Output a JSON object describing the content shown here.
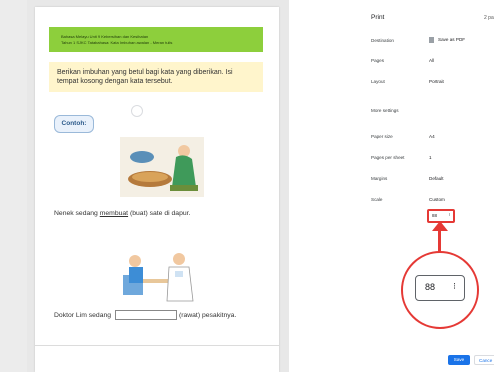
{
  "document": {
    "header_line1": "Bahasa Melayu   Unit 9 Kebersihan dan Kesihatan",
    "header_line2": "Tahun 1 SJKC     Tatabahasa: Kata Imbuhan awalan - Meran tulis",
    "instruction_line1": "Berikan imbuhan yang betul bagi kata yang diberikan. Isi",
    "instruction_line2": "tempat kosong dengan kata tersebut.",
    "example_label": "Contoh:",
    "sentence1_pre": "Nenek sedang ",
    "sentence1_answer": "membuat",
    "sentence1_post": " (buat) sate di dapur.",
    "sentence2_pre": "Doktor Lim sedang ",
    "sentence2_post": "(rawat) pesakitnya."
  },
  "print": {
    "title": "Print",
    "sheet_count": "2 pa",
    "destination_label": "Destination",
    "destination_value": "Save as PDF",
    "pages_label": "Pages",
    "pages_value": "All",
    "layout_label": "Layout",
    "layout_value": "Portrait",
    "more_settings_label": "More settings",
    "paper_size_label": "Paper size",
    "paper_size_value": "A4",
    "pages_per_sheet_label": "Pages per sheet",
    "pages_per_sheet_value": "1",
    "margins_label": "Margins",
    "margins_value": "Default",
    "scale_label": "Scale",
    "scale_value": "Custom",
    "scale_number": "88",
    "zoomed_scale_number": "88",
    "spinner_glyph": "⁝",
    "save_label": "Save",
    "cancel_label": "Cance"
  },
  "colors": {
    "header_green": "#8dcf3c",
    "instruction_yellow": "#fff5cc",
    "highlight_red": "#e53935",
    "primary_blue": "#1a73e8"
  }
}
